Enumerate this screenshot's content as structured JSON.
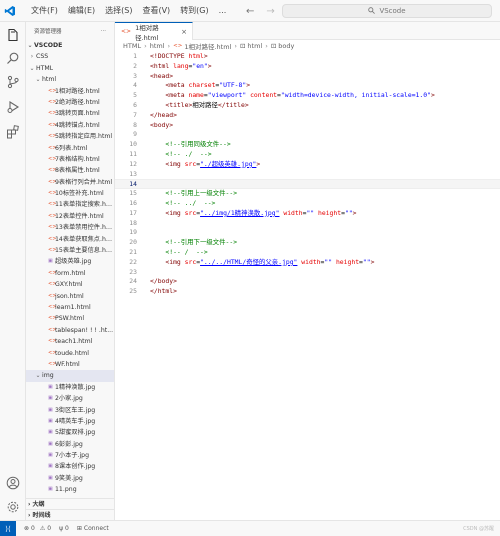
{
  "menu": [
    "文件(F)",
    "编辑(E)",
    "选择(S)",
    "查看(V)",
    "转到(G)",
    "..."
  ],
  "search": {
    "label": "VScode"
  },
  "explorer": {
    "title": "资源管理器",
    "more": "···",
    "root": "VSCODE"
  },
  "tree": [
    {
      "label": "CSS",
      "kind": "folder",
      "open": false,
      "depth": 1
    },
    {
      "label": "HTML",
      "kind": "folder",
      "open": true,
      "depth": 1
    },
    {
      "label": "html",
      "kind": "folder",
      "open": true,
      "depth": 2
    },
    {
      "label": "1相对路径.html",
      "kind": "html",
      "depth": 3,
      "selected": false
    },
    {
      "label": "2绝对路径.html",
      "kind": "html",
      "depth": 3
    },
    {
      "label": "3跳转页面.html",
      "kind": "html",
      "depth": 3
    },
    {
      "label": "4跳转锚点.html",
      "kind": "html",
      "depth": 3
    },
    {
      "label": "5跳转指定应用.html",
      "kind": "html",
      "depth": 3
    },
    {
      "label": "6列表.html",
      "kind": "html",
      "depth": 3
    },
    {
      "label": "7表格结构.html",
      "kind": "html",
      "depth": 3
    },
    {
      "label": "8表格属性.html",
      "kind": "html",
      "depth": 3
    },
    {
      "label": "9表格行列合并.html",
      "kind": "html",
      "depth": 3
    },
    {
      "label": "10标签补充.html",
      "kind": "html",
      "depth": 3
    },
    {
      "label": "11表单指定搜索.ht...",
      "kind": "html",
      "depth": 3
    },
    {
      "label": "12表单控件.html",
      "kind": "html",
      "depth": 3
    },
    {
      "label": "13表单禁用控件.ht...",
      "kind": "html",
      "depth": 3
    },
    {
      "label": "14表单获取焦点.ht...",
      "kind": "html",
      "depth": 3
    },
    {
      "label": "15表单主要信息.ht...",
      "kind": "html",
      "depth": 3
    },
    {
      "label": "超级英雄.jpg",
      "kind": "img",
      "depth": 3
    },
    {
      "label": "form.html",
      "kind": "html",
      "depth": 3
    },
    {
      "label": "GXY.html",
      "kind": "html",
      "depth": 3
    },
    {
      "label": "json.html",
      "kind": "html",
      "depth": 3
    },
    {
      "label": "learn1.html",
      "kind": "html",
      "depth": 3
    },
    {
      "label": "PSW.html",
      "kind": "html",
      "depth": 3
    },
    {
      "label": "tablespan! ! ! .ht...",
      "kind": "html",
      "depth": 3
    },
    {
      "label": "teach1.html",
      "kind": "html",
      "depth": 3
    },
    {
      "label": "toude.html",
      "kind": "html",
      "depth": 3
    },
    {
      "label": "WF.html",
      "kind": "html",
      "depth": 3
    },
    {
      "label": "img",
      "kind": "folder",
      "open": true,
      "depth": 2,
      "selected": true
    },
    {
      "label": "1精神涣散.jpg",
      "kind": "img",
      "depth": 3
    },
    {
      "label": "2小家.jpg",
      "kind": "img",
      "depth": 3
    },
    {
      "label": "3街区车王.jpg",
      "kind": "img",
      "depth": 3
    },
    {
      "label": "4晴英车手.jpg",
      "kind": "img",
      "depth": 3
    },
    {
      "label": "5甜蜜双排.jpg",
      "kind": "img",
      "depth": 3
    },
    {
      "label": "6彭彭.jpg",
      "kind": "img",
      "depth": 3
    },
    {
      "label": "7小本子.jpg",
      "kind": "img",
      "depth": 3
    },
    {
      "label": "8课本创作.jpg",
      "kind": "img",
      "depth": 3
    },
    {
      "label": "9笑美.jpg",
      "kind": "img",
      "depth": 3
    },
    {
      "label": "11.png",
      "kind": "img",
      "depth": 3
    }
  ],
  "bottom_sections": [
    "大纲",
    "时间线"
  ],
  "tab": {
    "label": "1相对路径.html",
    "close": "×"
  },
  "breadcrumb": [
    "HTML",
    "html",
    "1相对路径.html",
    "html",
    "body"
  ],
  "code": [
    {
      "n": "1",
      "parts": [
        [
          "tg",
          "<!DOCTYPE "
        ],
        [
          "at",
          "html"
        ],
        [
          "tg",
          ">"
        ]
      ]
    },
    {
      "n": "2",
      "parts": [
        [
          "tg",
          "<html "
        ],
        [
          "at",
          "lang"
        ],
        [
          "tx",
          "="
        ],
        [
          "st",
          "\"en\""
        ],
        [
          "tg",
          ">"
        ]
      ]
    },
    {
      "n": "3",
      "parts": [
        [
          "tg",
          "<head>"
        ]
      ]
    },
    {
      "n": "4",
      "parts": [
        [
          "tx",
          "    "
        ],
        [
          "tg",
          "<meta "
        ],
        [
          "at",
          "charset"
        ],
        [
          "tx",
          "="
        ],
        [
          "st",
          "\"UTF-8\""
        ],
        [
          "tg",
          ">"
        ]
      ]
    },
    {
      "n": "5",
      "parts": [
        [
          "tx",
          "    "
        ],
        [
          "tg",
          "<meta "
        ],
        [
          "at",
          "name"
        ],
        [
          "tx",
          "="
        ],
        [
          "st",
          "\"viewport\""
        ],
        [
          "tx",
          " "
        ],
        [
          "at",
          "content"
        ],
        [
          "tx",
          "="
        ],
        [
          "st",
          "\"width=device-width, initial-scale=1.0\""
        ],
        [
          "tg",
          ">"
        ]
      ]
    },
    {
      "n": "6",
      "parts": [
        [
          "tx",
          "    "
        ],
        [
          "tg",
          "<title>"
        ],
        [
          "tx",
          "相对路径"
        ],
        [
          "tg",
          "</title>"
        ]
      ]
    },
    {
      "n": "7",
      "parts": [
        [
          "tg",
          "</head>"
        ]
      ]
    },
    {
      "n": "8",
      "parts": [
        [
          "tg",
          "<body>"
        ]
      ]
    },
    {
      "n": "9",
      "parts": []
    },
    {
      "n": "10",
      "parts": [
        [
          "tx",
          "    "
        ],
        [
          "cm",
          "<!--引用同级文件-->"
        ]
      ]
    },
    {
      "n": "11",
      "parts": [
        [
          "tx",
          "    "
        ],
        [
          "cm",
          "<!-- ./  -->"
        ]
      ]
    },
    {
      "n": "12",
      "parts": [
        [
          "tx",
          "    "
        ],
        [
          "tg",
          "<img "
        ],
        [
          "at",
          "src"
        ],
        [
          "tx",
          "="
        ],
        [
          "st",
          "\"./超级英雄.jpg\""
        ],
        [
          "tg",
          ">"
        ]
      ]
    },
    {
      "n": "13",
      "parts": []
    },
    {
      "n": "14",
      "parts": [],
      "current": true
    },
    {
      "n": "15",
      "parts": [
        [
          "tx",
          "    "
        ],
        [
          "cm",
          "<!--引用上一级文件-->"
        ]
      ]
    },
    {
      "n": "16",
      "parts": [
        [
          "tx",
          "    "
        ],
        [
          "cm",
          "<!-- ../  -->"
        ]
      ]
    },
    {
      "n": "17",
      "parts": [
        [
          "tx",
          "    "
        ],
        [
          "tg",
          "<img "
        ],
        [
          "at",
          "src"
        ],
        [
          "tx",
          "="
        ],
        [
          "st",
          "\"../img/1精神涣散.jpg\""
        ],
        [
          "tx",
          " "
        ],
        [
          "at",
          "width"
        ],
        [
          "tx",
          "="
        ],
        [
          "st",
          "\"\""
        ],
        [
          "tx",
          " "
        ],
        [
          "at",
          "height"
        ],
        [
          "tx",
          "="
        ],
        [
          "st",
          "\"\""
        ],
        [
          "tg",
          ">"
        ]
      ]
    },
    {
      "n": "18",
      "parts": []
    },
    {
      "n": "19",
      "parts": []
    },
    {
      "n": "20",
      "parts": [
        [
          "tx",
          "    "
        ],
        [
          "cm",
          "<!--引用下一级文件-->"
        ]
      ]
    },
    {
      "n": "21",
      "parts": [
        [
          "tx",
          "    "
        ],
        [
          "cm",
          "<!-- /  -->"
        ]
      ]
    },
    {
      "n": "22",
      "parts": [
        [
          "tx",
          "    "
        ],
        [
          "tg",
          "<img "
        ],
        [
          "at",
          "src"
        ],
        [
          "tx",
          "="
        ],
        [
          "st",
          "\"../../HTML/奇怪的父亲.jpg\""
        ],
        [
          "tx",
          " "
        ],
        [
          "at",
          "width"
        ],
        [
          "tx",
          "="
        ],
        [
          "st",
          "\"\""
        ],
        [
          "tx",
          " "
        ],
        [
          "at",
          "height"
        ],
        [
          "tx",
          "="
        ],
        [
          "st",
          "\"\""
        ],
        [
          "tg",
          ">"
        ]
      ]
    },
    {
      "n": "23",
      "parts": []
    },
    {
      "n": "24",
      "parts": [
        [
          "tg",
          "</body>"
        ]
      ]
    },
    {
      "n": "25",
      "parts": [
        [
          "tg",
          "</html>"
        ]
      ]
    }
  ],
  "status": {
    "errors": "0",
    "warnings": "0",
    "ports": "0",
    "connect": "Connect",
    "watermark": "CSDN @苏醒"
  },
  "colors": {
    "accent": "#005fb8",
    "tag": "#800000",
    "attr": "#e50000",
    "string": "#0000ff",
    "comment": "#008000"
  }
}
